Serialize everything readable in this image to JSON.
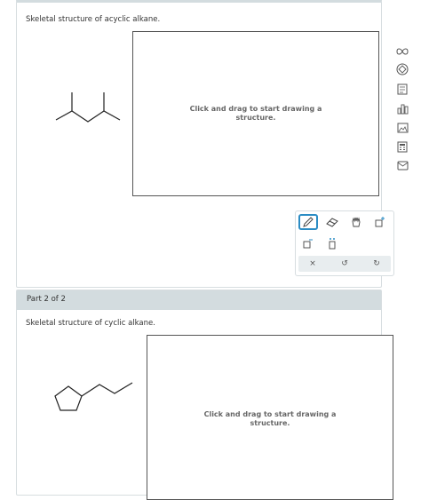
{
  "part1": {
    "prompt": "Skeletal structure of acyclic alkane.",
    "canvas_hint": "Click and drag to start drawing a structure."
  },
  "part2": {
    "header": "Part 2 of 2",
    "prompt": "Skeletal structure of cyclic alkane.",
    "canvas_hint": "Click and drag to start drawing a structure."
  },
  "toolbar": {
    "tools": [
      "pencil-icon",
      "eraser-icon",
      "hand-icon",
      "add-charge-plus-icon",
      "add-charge-minus-icon",
      "lone-pair-icon"
    ],
    "actions": {
      "clear": "×",
      "undo": "↺",
      "redo": "↻"
    },
    "accent_color": "#2b8cc4"
  },
  "sidebar": {
    "icons": [
      "infinity-icon",
      "diamond-icon",
      "notes-icon",
      "bar-chart-icon",
      "image-icon",
      "calculator-icon",
      "mail-icon"
    ]
  }
}
